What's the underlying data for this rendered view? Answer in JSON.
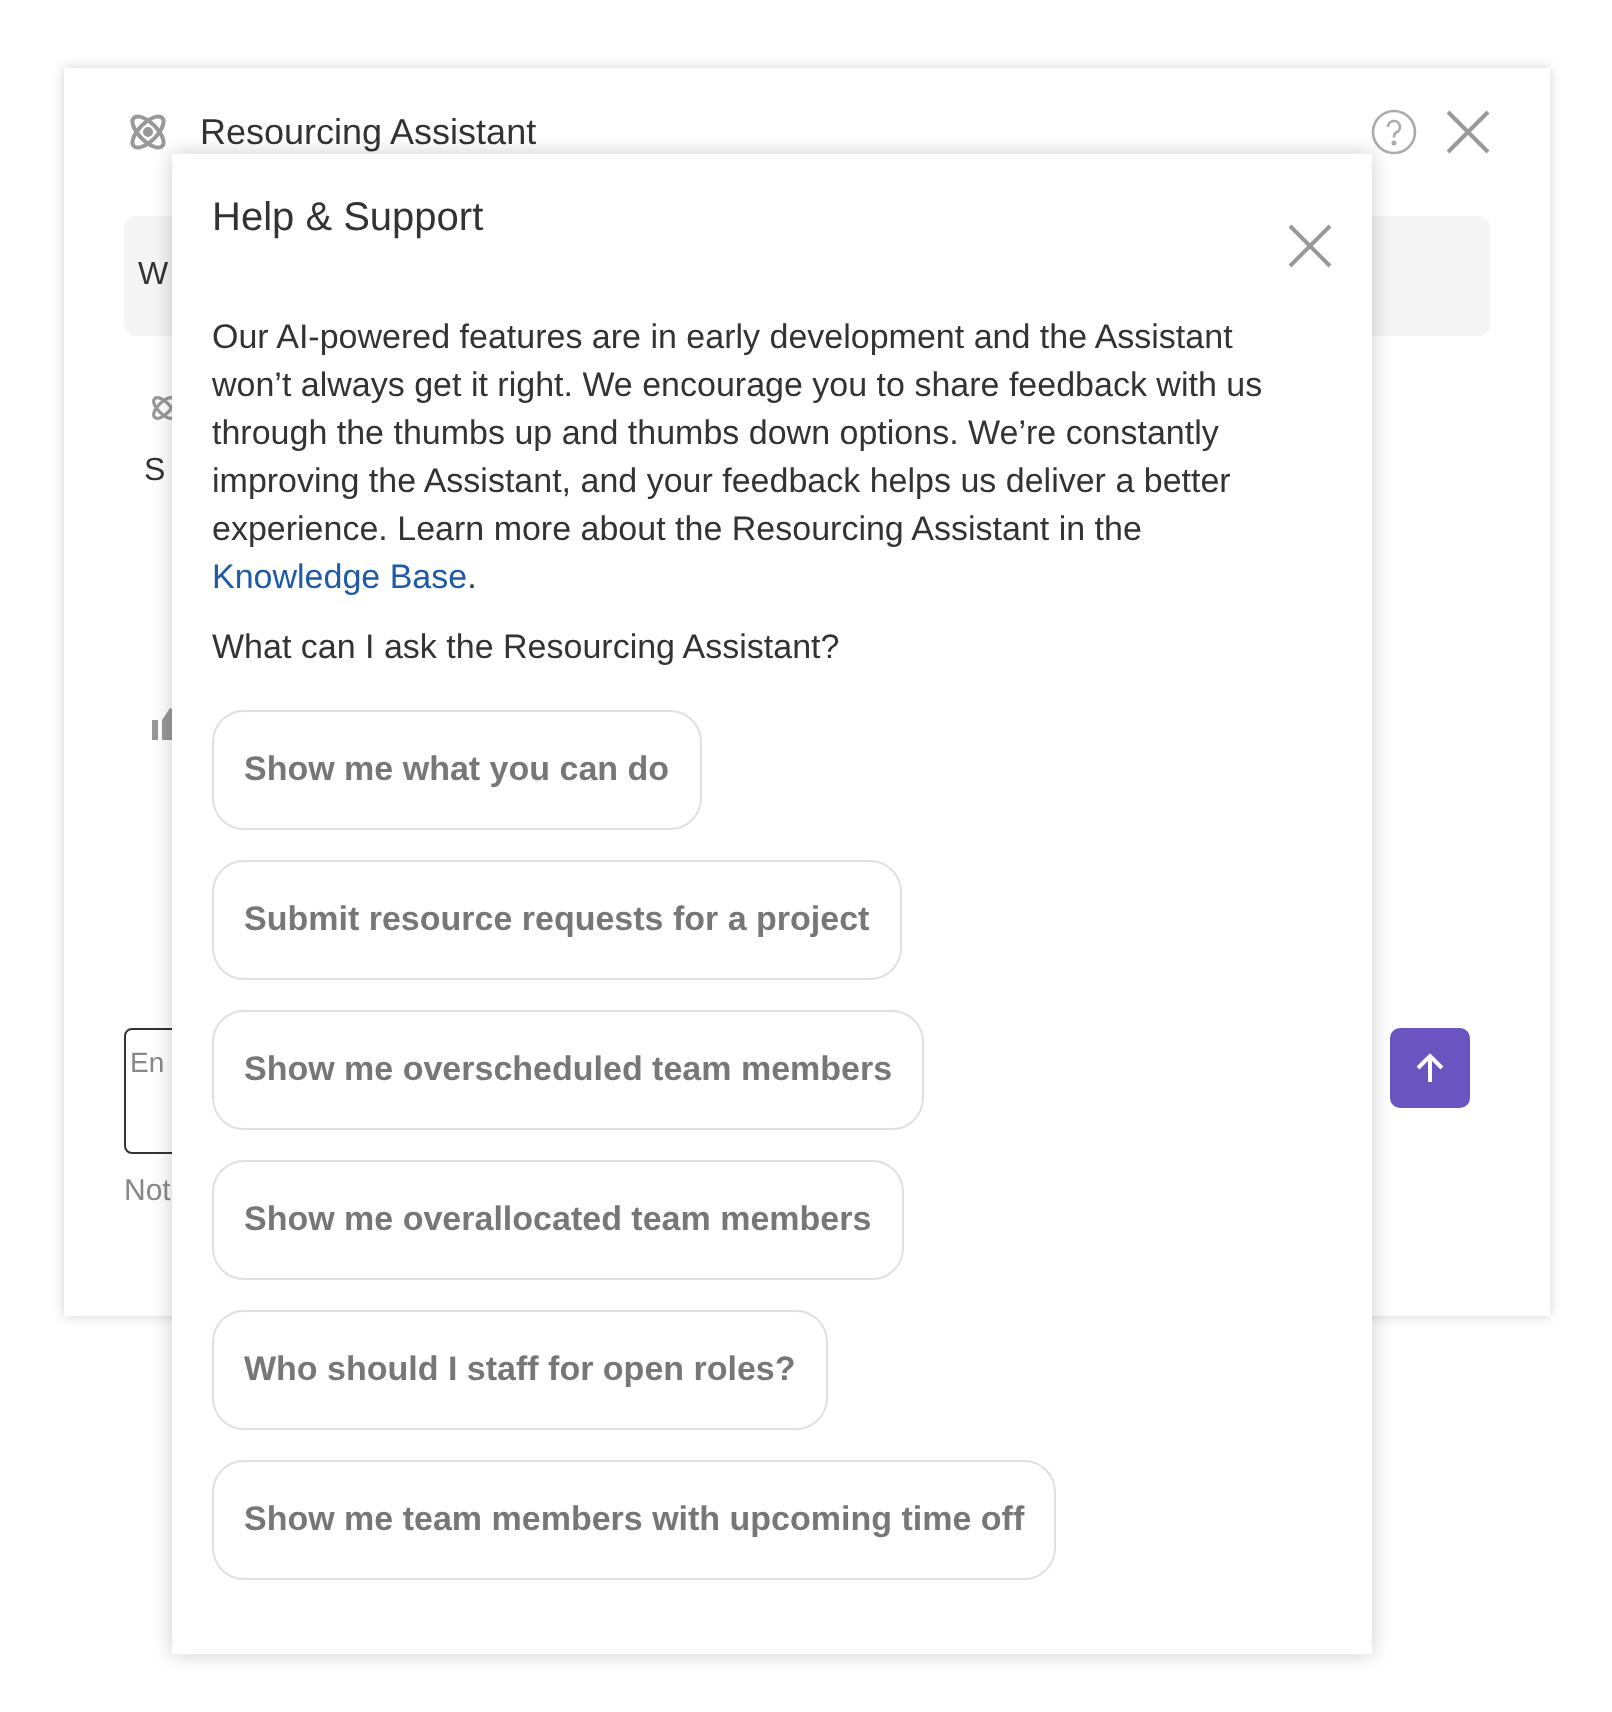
{
  "assistant_panel": {
    "title": "Resourcing Assistant",
    "message_preview": "W",
    "reply_preview": "S",
    "input": {
      "placeholder": "En"
    },
    "footnote": "Not"
  },
  "help_dialog": {
    "title": "Help & Support",
    "body": "Our AI-powered features are in early development and the Assistant won’t always get it right. We encourage you to share feedback with us through the thumbs up and thumbs down options. We’re constantly improving the Assistant, and your feedback helps us deliver a better experience. Learn more about the Resourcing Assistant in the ",
    "link": "Knowledge Base",
    "body_end": ".",
    "question": "What can I ask the Resourcing Assistant?",
    "suggestions": [
      "Show me what you can do",
      "Submit resource requests for a project",
      "Show me overscheduled team members",
      "Show me overallocated team members",
      "Who should I staff for open roles?",
      "Show me team members with upcoming time off"
    ]
  }
}
